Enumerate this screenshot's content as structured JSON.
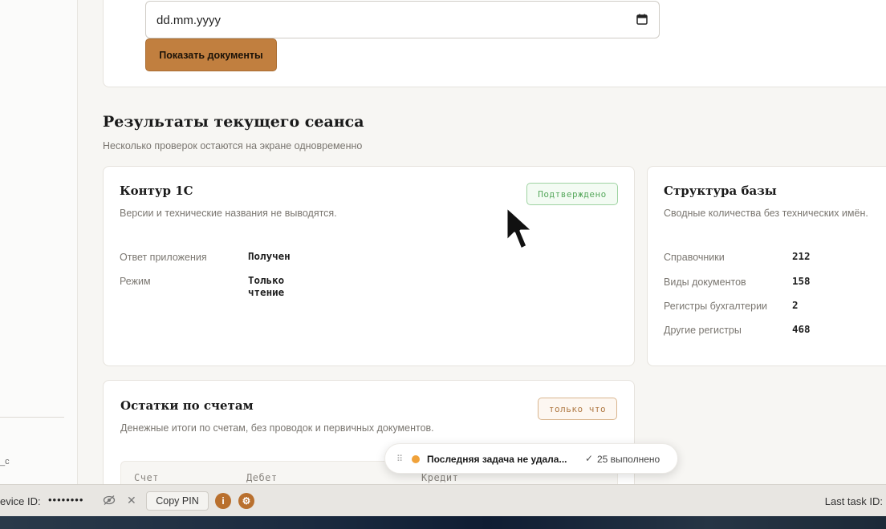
{
  "sidebar": {
    "fragment": "_c"
  },
  "filter": {
    "date_placeholder": "dd.mm.yyyy",
    "show_button": "Показать документы"
  },
  "section": {
    "title": "Результаты текущего сеанса",
    "subtitle": "Несколько проверок остаются на экране одновременно"
  },
  "cards": {
    "contour": {
      "title": "Контур 1С",
      "desc": "Версии и технические названия не выводятся.",
      "badge": "Подтверждено",
      "rows": [
        {
          "label": "Ответ приложения",
          "value": "Получен"
        },
        {
          "label": "Режим",
          "value": "Только чтение"
        }
      ]
    },
    "structure": {
      "title": "Структура базы",
      "desc": "Сводные количества без технических имён.",
      "rows": [
        {
          "label": "Справочники",
          "value": "212"
        },
        {
          "label": "Виды документов",
          "value": "158"
        },
        {
          "label": "Регистры бухгалтерии",
          "value": "2"
        },
        {
          "label": "Другие регистры",
          "value": "468"
        }
      ]
    },
    "balances": {
      "title": "Остатки по счетам",
      "desc": "Денежные итоги по счетам, без проводок и первичных документов.",
      "badge": "только что",
      "columns": [
        "Счет",
        "Дебет",
        "Кредит"
      ]
    }
  },
  "toast": {
    "message": "Последняя задача не удала...",
    "check": "✓",
    "completed": "25 выполнено"
  },
  "bottombar": {
    "device_label": "evice ID:",
    "device_masked": "••••••••",
    "copy_pin": "Copy PIN",
    "info_glyph": "i",
    "gear_glyph": "⚙",
    "close_glyph": "✕",
    "last_task": "Last task ID:"
  },
  "colors": {
    "accent": "#c17f3f",
    "confirmed": "#58a95e",
    "status_dot": "#f0a23a"
  }
}
